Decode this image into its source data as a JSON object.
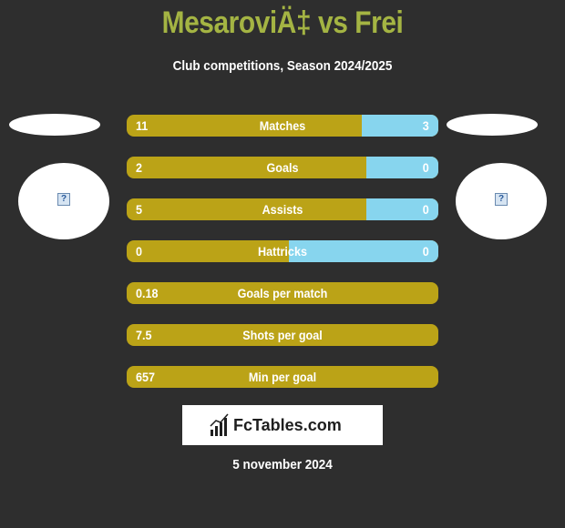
{
  "header": {
    "title": "MesaroviÄ‡ vs Frei",
    "subtitle": "Club competitions, Season 2024/2025"
  },
  "colors": {
    "background": "#2e2e2e",
    "title": "#a4b443",
    "left_bar": "#bba317",
    "right_bar": "#87d5ee"
  },
  "players": {
    "left": {
      "logo_icon": "broken-image-icon"
    },
    "right": {
      "logo_icon": "broken-image-icon"
    }
  },
  "stats": [
    {
      "label": "Matches",
      "left": "11",
      "right": "3",
      "right_fraction": 0.246
    },
    {
      "label": "Goals",
      "left": "2",
      "right": "0",
      "right_fraction": 0.23
    },
    {
      "label": "Assists",
      "left": "5",
      "right": "0",
      "right_fraction": 0.23
    },
    {
      "label": "Hattricks",
      "left": "0",
      "right": "0",
      "right_fraction": 0.48
    },
    {
      "label": "Goals per match",
      "left": "0.18",
      "right": "",
      "right_fraction": 0
    },
    {
      "label": "Shots per goal",
      "left": "7.5",
      "right": "",
      "right_fraction": 0
    },
    {
      "label": "Min per goal",
      "left": "657",
      "right": "",
      "right_fraction": 0
    }
  ],
  "brand": {
    "name": "FcTables.com",
    "icon": "bar-chart-icon"
  },
  "footer": {
    "date": "5 november 2024"
  }
}
